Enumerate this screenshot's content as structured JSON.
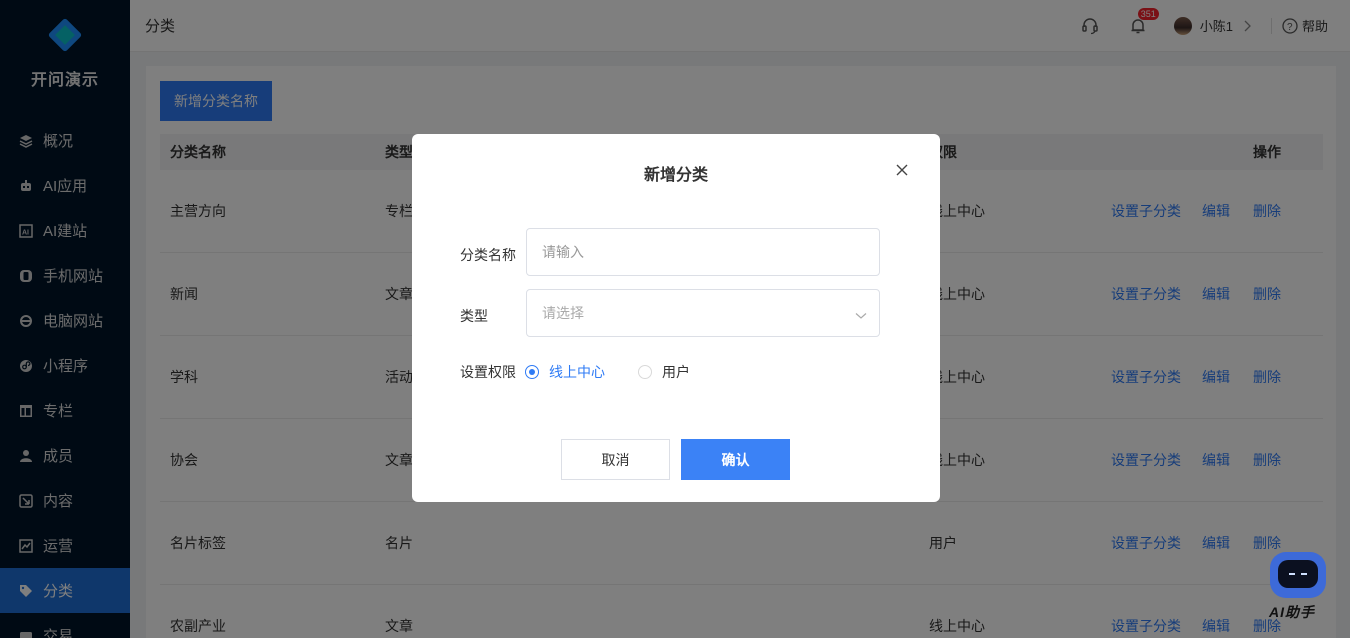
{
  "app": {
    "name": "开问演示"
  },
  "sidebar": {
    "items": [
      {
        "label": "概况",
        "icon": "layers-icon",
        "active": false
      },
      {
        "label": "AI应用",
        "icon": "robot-icon",
        "active": false
      },
      {
        "label": "AI建站",
        "icon": "ai-icon",
        "active": false
      },
      {
        "label": "手机网站",
        "icon": "mobile-icon",
        "active": false
      },
      {
        "label": "电脑网站",
        "icon": "ie-icon",
        "active": false
      },
      {
        "label": "小程序",
        "icon": "miniprogram-icon",
        "active": false
      },
      {
        "label": "专栏",
        "icon": "column-icon",
        "active": false
      },
      {
        "label": "成员",
        "icon": "user-icon",
        "active": false
      },
      {
        "label": "内容",
        "icon": "content-icon",
        "active": false
      },
      {
        "label": "运营",
        "icon": "chart-icon",
        "active": false
      },
      {
        "label": "分类",
        "icon": "tag-icon",
        "active": true
      },
      {
        "label": "交易",
        "icon": "trade-icon",
        "active": false
      }
    ]
  },
  "header": {
    "title": "分类",
    "notification_count": "351",
    "user_name": "小陈1",
    "help_label": "帮助"
  },
  "toolbar": {
    "add_label": "新增分类名称"
  },
  "table": {
    "headers": {
      "name": "分类名称",
      "type": "类型",
      "permission": "权限",
      "ops": "操作"
    },
    "rows": [
      {
        "name": "主营方向",
        "type": "专栏",
        "permission": "线上中心"
      },
      {
        "name": "新闻",
        "type": "文章",
        "permission": "线上中心"
      },
      {
        "name": "学科",
        "type": "活动",
        "permission": "线上中心"
      },
      {
        "name": "协会",
        "type": "文章",
        "permission": "线上中心"
      },
      {
        "name": "名片标签",
        "type": "名片",
        "permission": "用户"
      },
      {
        "name": "农副产业",
        "type": "文章",
        "permission": "线上中心"
      }
    ],
    "ops": {
      "set_sub": "设置子分类",
      "edit": "编辑",
      "delete": "删除"
    }
  },
  "modal": {
    "title": "新增分类",
    "name_label": "分类名称",
    "name_placeholder": "请输入",
    "type_label": "类型",
    "type_placeholder": "请选择",
    "perm_label": "设置权限",
    "perm_options": [
      {
        "label": "线上中心",
        "selected": true
      },
      {
        "label": "用户",
        "selected": false
      }
    ],
    "cancel_label": "取消",
    "ok_label": "确认"
  },
  "assistant": {
    "label": "AI助手"
  },
  "colors": {
    "sidebar_bg": "#001529",
    "accent": "#2f7bf5",
    "active_item": "#1f6fd6"
  }
}
